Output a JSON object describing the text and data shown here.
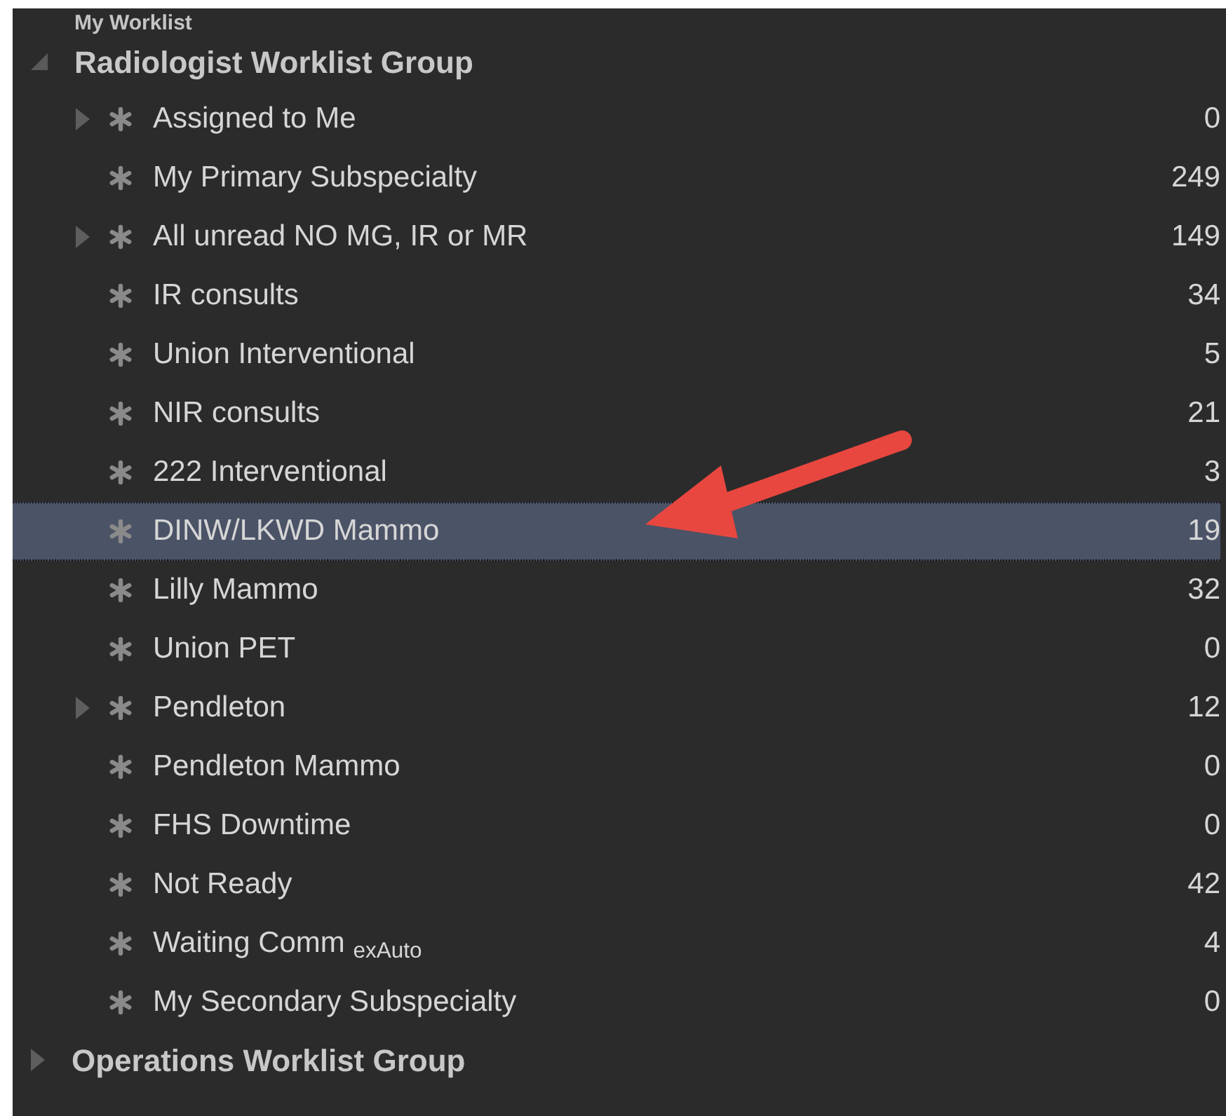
{
  "tree": {
    "groups": [
      {
        "label": "My Worklist",
        "kind": "cut"
      },
      {
        "label": "Radiologist Worklist Group",
        "kind": "group",
        "expanded": true,
        "children": [
          {
            "label": "Assigned to Me",
            "count": "0",
            "expandable": true,
            "selected": false
          },
          {
            "label": "My Primary Subspecialty",
            "count": "249",
            "expandable": false,
            "selected": false
          },
          {
            "label": "All unread NO MG, IR or MR",
            "count": "149",
            "expandable": true,
            "selected": false
          },
          {
            "label": "IR consults",
            "count": "34",
            "expandable": false,
            "selected": false
          },
          {
            "label": "Union Interventional",
            "count": "5",
            "expandable": false,
            "selected": false
          },
          {
            "label": "NIR consults",
            "count": "21",
            "expandable": false,
            "selected": false
          },
          {
            "label": "222 Interventional",
            "count": "3",
            "expandable": false,
            "selected": false
          },
          {
            "label": "DINW/LKWD Mammo",
            "count": "19",
            "expandable": false,
            "selected": true
          },
          {
            "label": "Lilly Mammo",
            "count": "32",
            "expandable": false,
            "selected": false
          },
          {
            "label": "Union PET",
            "count": "0",
            "expandable": false,
            "selected": false
          },
          {
            "label": "Pendleton",
            "count": "12",
            "expandable": true,
            "selected": false
          },
          {
            "label": "Pendleton Mammo",
            "count": "0",
            "expandable": false,
            "selected": false
          },
          {
            "label": "FHS Downtime",
            "count": "0",
            "expandable": false,
            "selected": false
          },
          {
            "label": "Not Ready",
            "count": "42",
            "expandable": false,
            "selected": false
          },
          {
            "label": "Waiting Comm $_{exAuto}$",
            "count": "4",
            "expandable": false,
            "selected": false
          },
          {
            "label": "My Secondary Subspecialty",
            "count": "0",
            "expandable": false,
            "selected": false
          }
        ]
      },
      {
        "label": "Operations Worklist Group",
        "kind": "group",
        "expanded": false
      }
    ]
  }
}
